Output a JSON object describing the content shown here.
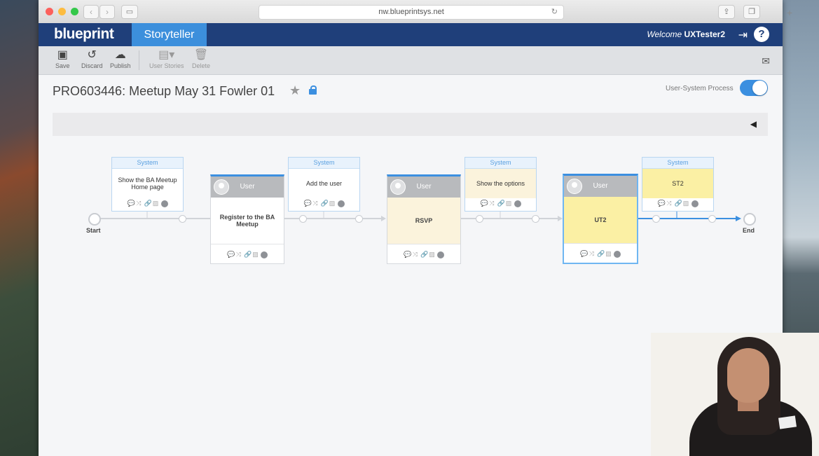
{
  "browser": {
    "url": "nw.blueprintsys.net",
    "back_icon": "chevron-left",
    "forward_icon": "chevron-right"
  },
  "app": {
    "logo": "blueprint",
    "active_tab": "Storyteller",
    "welcome_prefix": "Welcome",
    "username": "UXTester2"
  },
  "toolbar": {
    "save": "Save",
    "discard": "Discard",
    "publish": "Publish",
    "user_stories": "User Stories",
    "delete": "Delete"
  },
  "page": {
    "title": "PRO603446: Meetup May 31 Fowler 01",
    "toggle_label": "User-System Process",
    "toggle_on": true
  },
  "process": {
    "start_label": "Start",
    "end_label": "End",
    "system_header": "System",
    "user_header": "User",
    "system_tasks": [
      {
        "text": "Show the BA Meetup Home page",
        "fill": "white"
      },
      {
        "text": "Add the user",
        "fill": "white"
      },
      {
        "text": "Show the options",
        "fill": "cream"
      },
      {
        "text": "ST2",
        "fill": "yellow"
      }
    ],
    "user_tasks": [
      {
        "text": "Register to the BA Meetup",
        "fill": "white"
      },
      {
        "text": "RSVP",
        "fill": "cream"
      },
      {
        "text": "UT2",
        "fill": "yellow",
        "selected": true
      }
    ],
    "accent_color": "#3b8fe0"
  }
}
